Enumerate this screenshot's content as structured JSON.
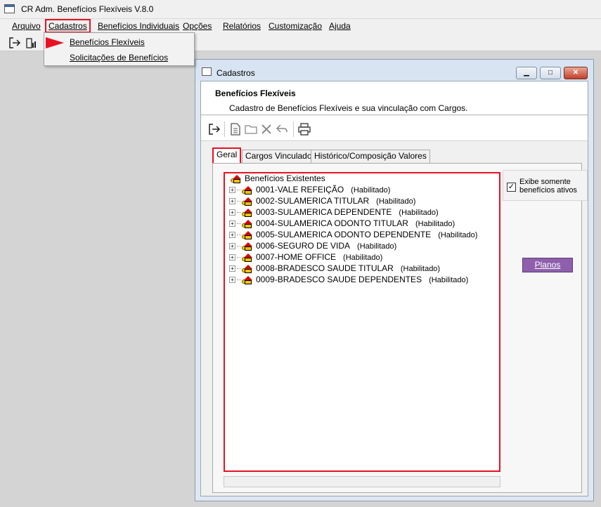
{
  "app": {
    "title": "CR Adm. Benefícios Flexíveis V.8.0"
  },
  "menu": {
    "items": [
      "Arquivo",
      "Cadastros",
      "Benefícios Individuais",
      "Opções",
      "Relatórios",
      "Customização",
      "Ajuda"
    ],
    "active": "Cadastros"
  },
  "dropdown": {
    "items": [
      "Benefícios Flexíveis",
      "Solicitações de Benefícios"
    ]
  },
  "window": {
    "title": "Cadastros",
    "header_title": "Benefícios Flexíveis",
    "header_subtitle": "Cadastro de Benefícios Flexíveis e sua vinculação com Cargos.",
    "window_buttons": {
      "minimize": "▁",
      "maximize": "□",
      "close": "✕"
    }
  },
  "tabs": [
    "Geral",
    "Cargos Vinculados",
    "Histórico/Composição Valores"
  ],
  "tree": {
    "root": "Benefícios Existentes",
    "items": [
      {
        "name": "0001-VALE REFEIÇÃO",
        "status": "(Habilitado)"
      },
      {
        "name": "0002-SULAMERICA TITULAR",
        "status": "(Habilitado)"
      },
      {
        "name": "0003-SULAMERICA DEPENDENTE",
        "status": "(Habilitado)"
      },
      {
        "name": "0004-SULAMERICA ODONTO TITULAR",
        "status": "(Habilitado)"
      },
      {
        "name": "0005-SULAMERICA ODONTO DEPENDENTE",
        "status": "(Habilitado)"
      },
      {
        "name": "0006-SEGURO DE VIDA",
        "status": "(Habilitado)"
      },
      {
        "name": "0007-HOME OFFICE",
        "status": "(Habilitado)"
      },
      {
        "name": "0008-BRADESCO SAUDE TITULAR",
        "status": "(Habilitado)"
      },
      {
        "name": "0009-BRADESCO SAUDE DEPENDENTES",
        "status": "(Habilitado)"
      }
    ]
  },
  "side": {
    "checkbox_label_1": "Exibe somente",
    "checkbox_label_2": "benefícios ativos",
    "checked": true,
    "planos_button": "Planos"
  },
  "icons": {
    "toolbar": [
      "exit-icon",
      "report-icon"
    ],
    "inner_toolbar": [
      "exit-icon",
      "new-document-icon",
      "open-folder-icon",
      "delete-icon",
      "undo-icon",
      "print-icon"
    ]
  },
  "colors": {
    "highlight": "#e81123",
    "planos_bg": "#8e5fac",
    "titlebar": "#d8e4f1"
  }
}
